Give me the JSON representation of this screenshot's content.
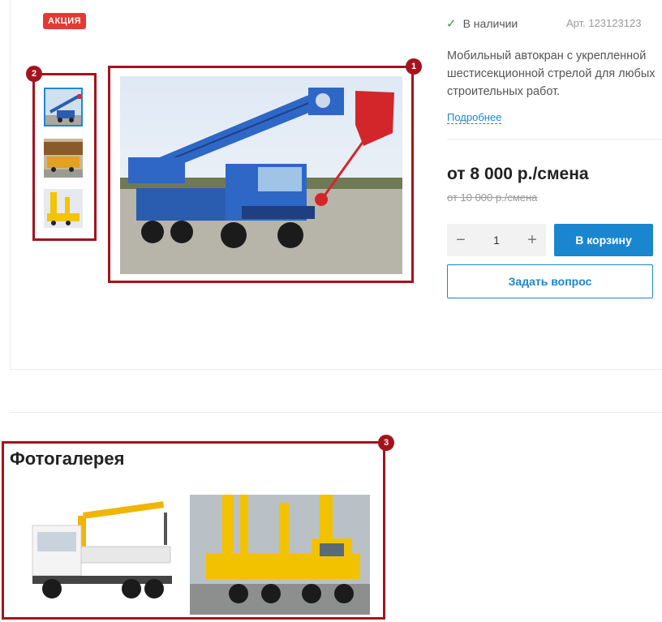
{
  "badge": {
    "sale": "АКЦИЯ"
  },
  "markers": [
    "1",
    "2",
    "3"
  ],
  "product": {
    "stock": "В наличии",
    "sku": "Арт. 123123123",
    "description": "Мобильный автокран с укрепленной шестисекционной стрелой для любых строительных работ.",
    "more_link": "Подробнее",
    "price": "от 8 000 р./смена",
    "old_price": "от 10 000 р./смена",
    "quantity": "1",
    "minus": "−",
    "plus": "+",
    "cart_button": "В корзину",
    "ask_button": "Задать вопрос"
  },
  "gallery": {
    "title": "Фотогалерея"
  },
  "colors": {
    "accent": "#1a86d0",
    "marker": "#a3141e",
    "badge": "#e53935",
    "stock_ok": "#2e9e48"
  },
  "icons": {
    "stock": "check-icon"
  }
}
